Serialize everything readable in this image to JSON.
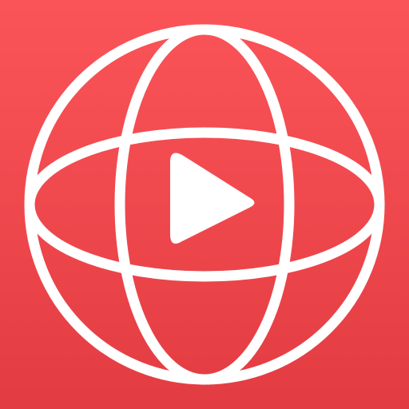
{
  "app_icon": {
    "name": "globe-play-icon",
    "colors": {
      "background_top": "#fb5458",
      "background_bottom": "#e23c42",
      "glyph": "#ffffff"
    }
  }
}
